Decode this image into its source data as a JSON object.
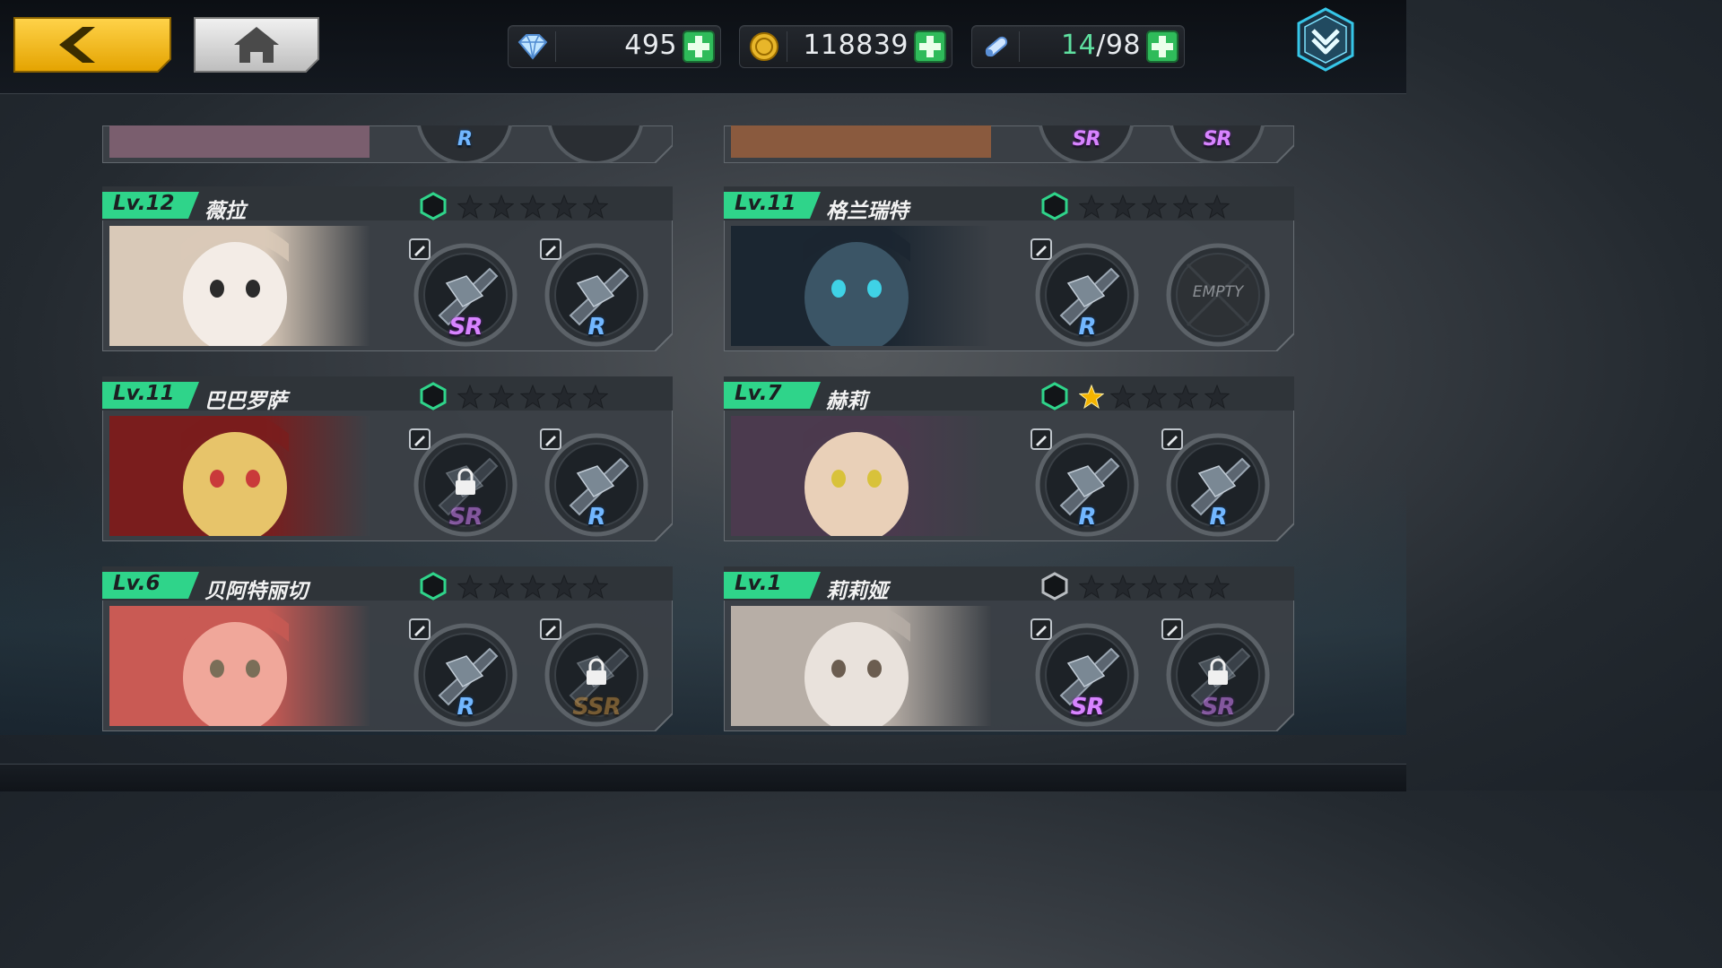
{
  "colors": {
    "accent_green": "#2fd48a",
    "gold": "#f4b400",
    "panel": "#3c4248"
  },
  "header": {
    "back_icon": "chevron-left-icon",
    "home_icon": "home-icon",
    "menu_icon": "chevron-down-icon",
    "resources": [
      {
        "icon": "diamond-icon",
        "value": "495"
      },
      {
        "icon": "gold-coin-icon",
        "value": "118839"
      },
      {
        "icon": "stamina-vial-icon",
        "current": "14",
        "max": "/98"
      }
    ]
  },
  "characters": [
    {
      "level": "Lv.12",
      "name": "薇拉",
      "stars": 0,
      "hex_active": true,
      "slots": [
        {
          "icon": "death-box-icon",
          "rarity": "SR",
          "locked": false,
          "edit": true
        },
        {
          "icon": "cannon-icon",
          "rarity": "R",
          "locked": false,
          "edit": true
        }
      ]
    },
    {
      "level": "Lv.11",
      "name": "格兰瑞特",
      "stars": 0,
      "hex_active": true,
      "slots": [
        {
          "icon": "scythe-icon",
          "rarity": "R",
          "locked": false,
          "edit": true
        },
        {
          "icon": "empty-slot-icon",
          "rarity": "",
          "locked": false,
          "edit": false,
          "empty_label": "EMPTY"
        }
      ]
    },
    {
      "level": "Lv.11",
      "name": "巴巴罗萨",
      "stars": 0,
      "hex_active": true,
      "slots": [
        {
          "icon": "pistol-icon",
          "rarity": "SR",
          "locked": true,
          "edit": true
        },
        {
          "icon": "fish-icon",
          "rarity": "R",
          "locked": false,
          "edit": true
        }
      ]
    },
    {
      "level": "Lv.7",
      "name": "赫莉",
      "stars": 1,
      "hex_active": true,
      "slots": [
        {
          "icon": "rifle-icon",
          "rarity": "R",
          "locked": false,
          "edit": true
        },
        {
          "icon": "chainsaw-blade-icon",
          "rarity": "R",
          "locked": false,
          "edit": true
        }
      ]
    },
    {
      "level": "Lv.6",
      "name": "贝阿特丽切",
      "stars": 0,
      "hex_active": true,
      "slots": [
        {
          "icon": "sword-icon",
          "rarity": "R",
          "locked": false,
          "edit": true
        },
        {
          "icon": "spear-icon",
          "rarity": "SSR",
          "locked": true,
          "edit": true
        }
      ]
    },
    {
      "level": "Lv.1",
      "name": "莉莉娅",
      "stars": 0,
      "hex_active": false,
      "slots": [
        {
          "icon": "gauntlet-icon",
          "rarity": "SR",
          "locked": false,
          "edit": true
        },
        {
          "icon": "gauntlet-icon",
          "rarity": "SR",
          "locked": true,
          "edit": true
        }
      ]
    }
  ],
  "partial_top": [
    {
      "rarities": [
        "R",
        ""
      ]
    },
    {
      "rarities": [
        "SR",
        "SR"
      ]
    }
  ]
}
